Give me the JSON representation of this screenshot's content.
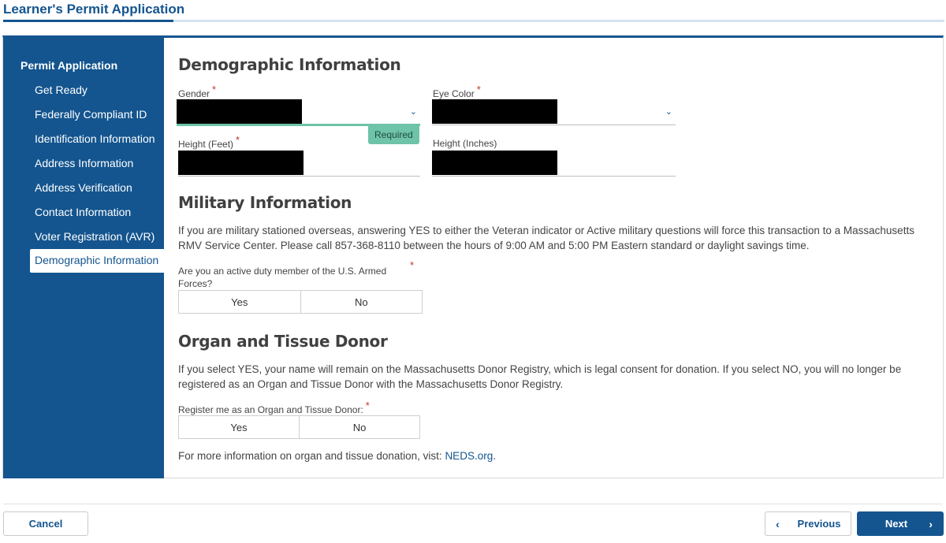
{
  "app": {
    "title": "Learner's Permit Application"
  },
  "sidebar": {
    "heading": "Permit Application",
    "items": [
      {
        "label": "Get Ready"
      },
      {
        "label": "Federally Compliant ID"
      },
      {
        "label": "Identification Information"
      },
      {
        "label": "Address Information"
      },
      {
        "label": "Address Verification"
      },
      {
        "label": "Contact Information"
      },
      {
        "label": "Voter Registration (AVR)"
      },
      {
        "label": "Demographic Information",
        "active": true
      }
    ]
  },
  "demographic": {
    "title": "Demographic Information",
    "gender_label": "Gender",
    "eye_color_label": "Eye Color",
    "height_feet_label": "Height (Feet)",
    "height_inches_label": "Height (Inches)",
    "required_tag": "Required",
    "required_mark": "*"
  },
  "military": {
    "title": "Military Information",
    "description": "If you are military stationed overseas, answering YES to either the Veteran indicator or Active military questions will force this transaction to a Massachusetts RMV Service Center. Please call 857-368-8110 between the hours of 9:00 AM and 5:00 PM Eastern standard or daylight savings time.",
    "question": "Are you an active duty member of the U.S. Armed Forces?",
    "yes": "Yes",
    "no": "No"
  },
  "donor": {
    "title": "Organ and Tissue Donor",
    "description": "If you select YES, your name will remain on the Massachusetts Donor Registry, which is legal consent for donation. If you select NO, you will no longer be registered as an Organ and Tissue Donor with the Massachusetts Donor Registry.",
    "question": "Register me as an Organ and Tissue Donor:",
    "yes": "Yes",
    "no": "No",
    "more_info_prefix": "For more information on organ and tissue donation, vist: ",
    "more_info_link": "NEDS.org",
    "more_info_suffix": "."
  },
  "footer": {
    "cancel": "Cancel",
    "previous": "Previous",
    "next": "Next"
  },
  "colors": {
    "primary": "#14558f",
    "required_green": "#6ec3a8",
    "required_star": "#c0392b"
  }
}
